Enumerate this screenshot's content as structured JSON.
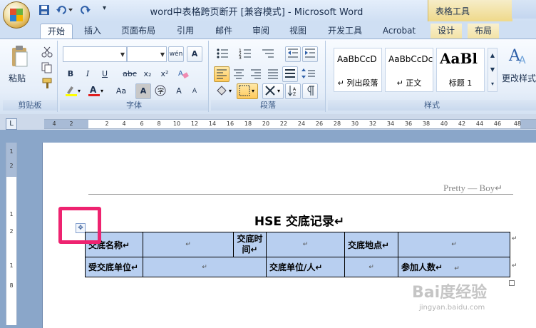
{
  "window": {
    "title": "word中表格跨页断开 [兼容模式] - Microsoft Word",
    "context_tab_title": "表格工具"
  },
  "tabs": [
    {
      "label": "开始",
      "active": true
    },
    {
      "label": "插入"
    },
    {
      "label": "页面布局"
    },
    {
      "label": "引用"
    },
    {
      "label": "邮件"
    },
    {
      "label": "审阅"
    },
    {
      "label": "视图"
    },
    {
      "label": "开发工具"
    },
    {
      "label": "Acrobat"
    },
    {
      "label": "设计",
      "contextual": true
    },
    {
      "label": "布局",
      "contextual": true
    }
  ],
  "ribbon": {
    "clipboard": {
      "label": "剪贴板",
      "paste": "粘贴"
    },
    "font": {
      "label": "字体",
      "wen": "wén",
      "bold": "B",
      "italic": "I",
      "underline": "U",
      "strike": "abc",
      "sub": "x₂",
      "sup": "x²",
      "case": "Aa",
      "char_border": "A",
      "grow": "A",
      "shrink": "A"
    },
    "paragraph": {
      "label": "段落"
    },
    "styles": {
      "label": "样式",
      "items": [
        {
          "sample": "AaBbCcD",
          "name": "↵ 列出段落"
        },
        {
          "sample": "AaBbCcDc",
          "name": "↵ 正文"
        },
        {
          "sample": "AaBl",
          "name": "标题 1"
        }
      ],
      "change_styles": "更改样式"
    }
  },
  "ruler": {
    "corner": "L",
    "ticks": [
      "4",
      "2",
      "",
      "2",
      "4",
      "6",
      "8",
      "10",
      "12",
      "14",
      "16",
      "18",
      "20",
      "22",
      "24",
      "26",
      "28",
      "30",
      "32",
      "34",
      "36",
      "38",
      "40",
      "42",
      "44",
      "46",
      "48"
    ],
    "vticks": [
      "1",
      "2",
      "1",
      "2",
      "1",
      "8"
    ]
  },
  "document": {
    "header_text": "Pretty — Boy↵",
    "title": "HSE 交底记录↵",
    "move_handle": "✥",
    "table": {
      "row1": [
        "交底名称↵",
        "↵",
        "交底时间↵",
        "↵",
        "交底地点↵",
        "↵"
      ],
      "row2": [
        "受交底单位↵",
        "↵",
        "交底单位/人↵",
        "↵",
        "参加人数↵",
        "↵"
      ],
      "row_end": "↵"
    }
  },
  "watermark": {
    "text": "Bai度经验",
    "url": "jingyan.baidu.com"
  },
  "colors": {
    "highlight_box": "#ee2370",
    "table_fill": "#b8cff0",
    "ribbon_bg": "#e5eef9"
  }
}
